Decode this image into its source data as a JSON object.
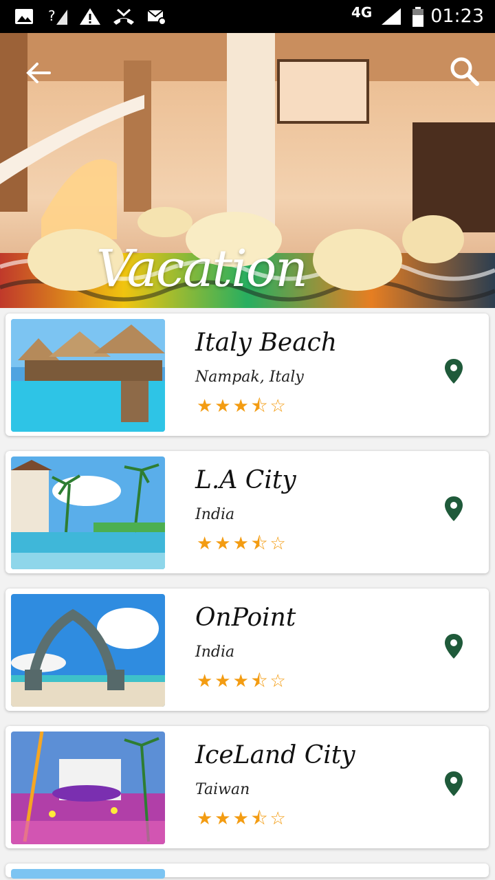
{
  "status_bar": {
    "network": "4G",
    "time": "01:23"
  },
  "header": {
    "title": "Vacation",
    "back_icon": "arrow-left-icon",
    "search_icon": "search-icon"
  },
  "places": [
    {
      "name": "Italy Beach",
      "location": "Nampak, Italy",
      "rating": 3.5,
      "stars": "★★★⯪☆"
    },
    {
      "name": "L.A City",
      "location": "India",
      "rating": 3.5,
      "stars": "★★★⯪☆"
    },
    {
      "name": "OnPoint",
      "location": "India",
      "rating": 3.5,
      "stars": "★★★⯪☆"
    },
    {
      "name": "IceLand City",
      "location": "Taiwan",
      "rating": 3.5,
      "stars": "★★★⯪☆"
    }
  ],
  "colors": {
    "star": "#f39c12",
    "pin": "#1f5a3a"
  }
}
